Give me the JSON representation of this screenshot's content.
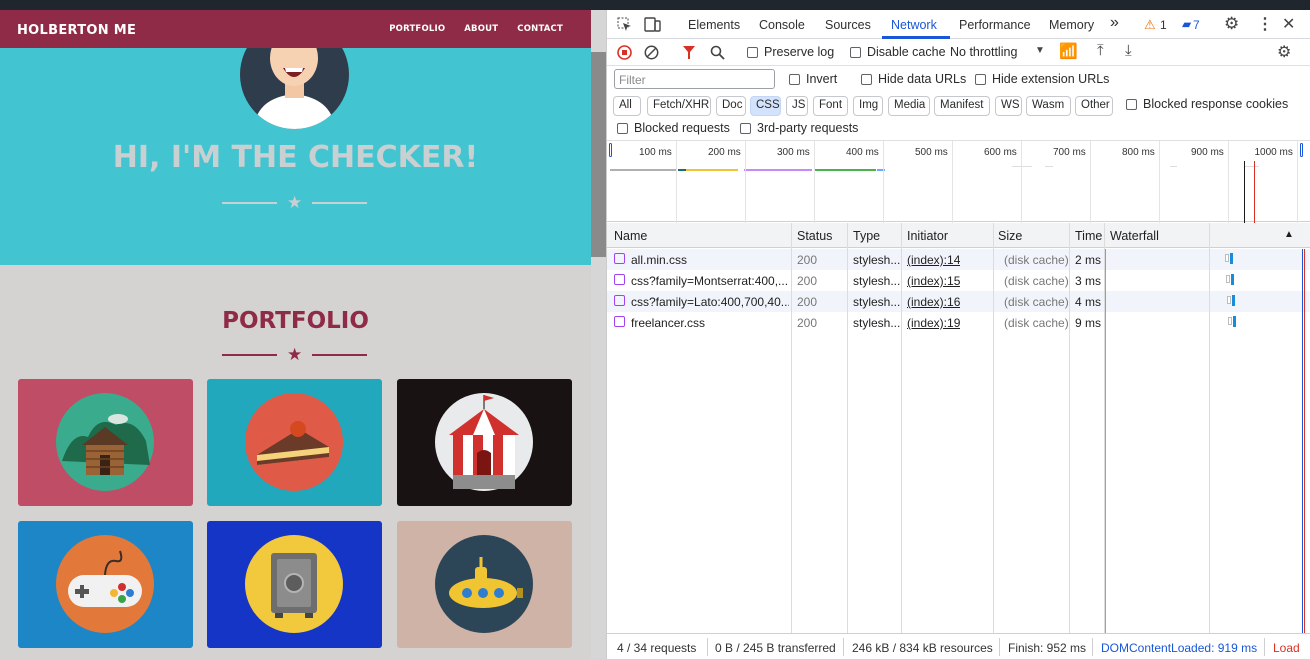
{
  "page": {
    "brand": "HOLBERTON ME",
    "nav": [
      "PORTFOLIO",
      "ABOUT",
      "CONTACT"
    ],
    "hero_title": "HI, I'M THE CHECKER!",
    "portfolio_title": "PORTFOLIO",
    "colors": {
      "navbar": "#8f2b47",
      "hero": "#42c5d1",
      "accent": "#8f2b47"
    },
    "tiles": [
      {
        "name": "cabin",
        "bg": "#bf4d66",
        "circle": "#3bab8e"
      },
      {
        "name": "cake",
        "bg": "#21a8bd",
        "circle": "#e05a48"
      },
      {
        "name": "circus",
        "bg": "#181212",
        "circle": "#e9eaeb"
      },
      {
        "name": "game-controller",
        "bg": "#1d86c6",
        "circle": "#e2793a"
      },
      {
        "name": "safe",
        "bg": "#1535c7",
        "circle": "#f2c93c"
      },
      {
        "name": "submarine",
        "bg": "#cfb3a6",
        "circle": "#2c4658"
      }
    ]
  },
  "devtools": {
    "tabs": [
      "Elements",
      "Console",
      "Sources",
      "Network",
      "Performance",
      "Memory"
    ],
    "active_tab": "Network",
    "warning_count": "1",
    "message_count": "7",
    "toolbar": {
      "preserve_log": "Preserve log",
      "disable_cache": "Disable cache",
      "throttling": "No throttling"
    },
    "filter": {
      "placeholder": "Filter",
      "invert": "Invert",
      "hide_data_urls": "Hide data URLs",
      "hide_extension_urls": "Hide extension URLs",
      "types": [
        "All",
        "Fetch/XHR",
        "Doc",
        "CSS",
        "JS",
        "Font",
        "Img",
        "Media",
        "Manifest",
        "WS",
        "Wasm",
        "Other"
      ],
      "active_type": "CSS",
      "blocked_response_cookies": "Blocked response cookies",
      "blocked_requests": "Blocked requests",
      "third_party": "3rd-party requests"
    },
    "timeline_ticks": [
      "100 ms",
      "200 ms",
      "300 ms",
      "400 ms",
      "500 ms",
      "600 ms",
      "700 ms",
      "800 ms",
      "900 ms",
      "1000 ms"
    ],
    "columns": [
      "Name",
      "Status",
      "Type",
      "Initiator",
      "Size",
      "Time",
      "Waterfall"
    ],
    "requests": [
      {
        "name": "all.min.css",
        "status": "200",
        "type": "stylesh...",
        "initiator": "(index):14",
        "size": "(disk cache)",
        "time": "2 ms"
      },
      {
        "name": "css?family=Montserrat:400,...",
        "status": "200",
        "type": "stylesh...",
        "initiator": "(index):15",
        "size": "(disk cache)",
        "time": "3 ms"
      },
      {
        "name": "css?family=Lato:400,700,40...",
        "status": "200",
        "type": "stylesh...",
        "initiator": "(index):16",
        "size": "(disk cache)",
        "time": "4 ms"
      },
      {
        "name": "freelancer.css",
        "status": "200",
        "type": "stylesh...",
        "initiator": "(index):19",
        "size": "(disk cache)",
        "time": "9 ms"
      }
    ],
    "status_bar": {
      "requests": "4 / 34 requests",
      "transferred": "0 B / 245 B transferred",
      "resources": "246 kB / 834 kB resources",
      "finish": "Finish: 952 ms",
      "dom_content_loaded": "DOMContentLoaded: 919 ms",
      "load": "Load"
    },
    "colors": {
      "accent": "#1a56d8",
      "dcl": "#1a56d8",
      "load": "#d93025"
    }
  }
}
